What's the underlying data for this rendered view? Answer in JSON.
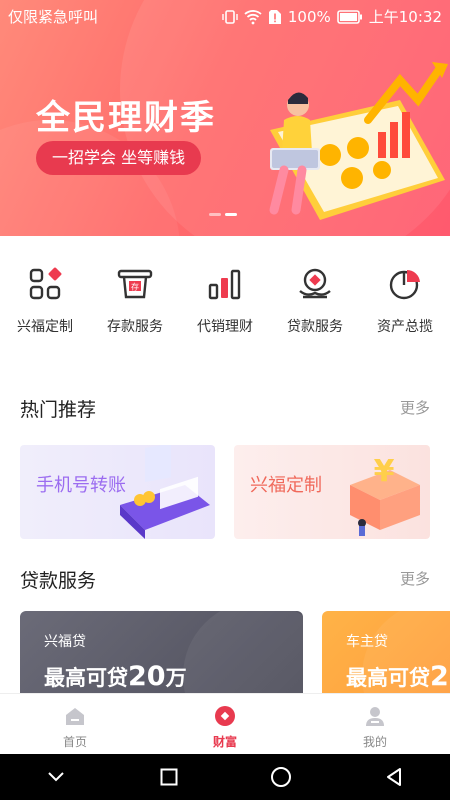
{
  "status_bar": {
    "carrier": "仅限紧急呼叫",
    "battery": "100%",
    "time": "上午10:32"
  },
  "banner": {
    "title": "全民理财季",
    "subtitle": "一招学会 坐等赚钱",
    "page_count": 2,
    "active_page": 2
  },
  "quick_menu": [
    {
      "label": "兴福定制",
      "icon": "apps-grid-icon"
    },
    {
      "label": "存款服务",
      "icon": "deposit-icon"
    },
    {
      "label": "代销理财",
      "icon": "bar-chart-icon"
    },
    {
      "label": "贷款服务",
      "icon": "loan-hand-icon"
    },
    {
      "label": "资产总揽",
      "icon": "pie-chart-icon"
    }
  ],
  "hot": {
    "title": "热门推荐",
    "more": "更多",
    "cards": [
      {
        "label": "手机号转账"
      },
      {
        "label": "兴福定制"
      }
    ]
  },
  "loans": {
    "title": "贷款服务",
    "more": "更多",
    "cards": [
      {
        "name": "兴福贷",
        "prefix": "最高可贷",
        "amount": "20",
        "unit": "万"
      },
      {
        "name": "车主贷",
        "prefix": "最高可贷",
        "amount": "2",
        "unit": ""
      }
    ]
  },
  "tabbar": {
    "tabs": [
      {
        "label": "首页",
        "icon": "home-icon"
      },
      {
        "label": "财富",
        "icon": "wealth-icon"
      },
      {
        "label": "我的",
        "icon": "profile-icon"
      }
    ],
    "active": "财富"
  },
  "colors": {
    "accent": "#e83a4f",
    "banner_start": "#ff8a7a",
    "banner_end": "#ff5a6e",
    "loan_grey": "#5a5a66",
    "loan_orange": "#ffa640"
  }
}
